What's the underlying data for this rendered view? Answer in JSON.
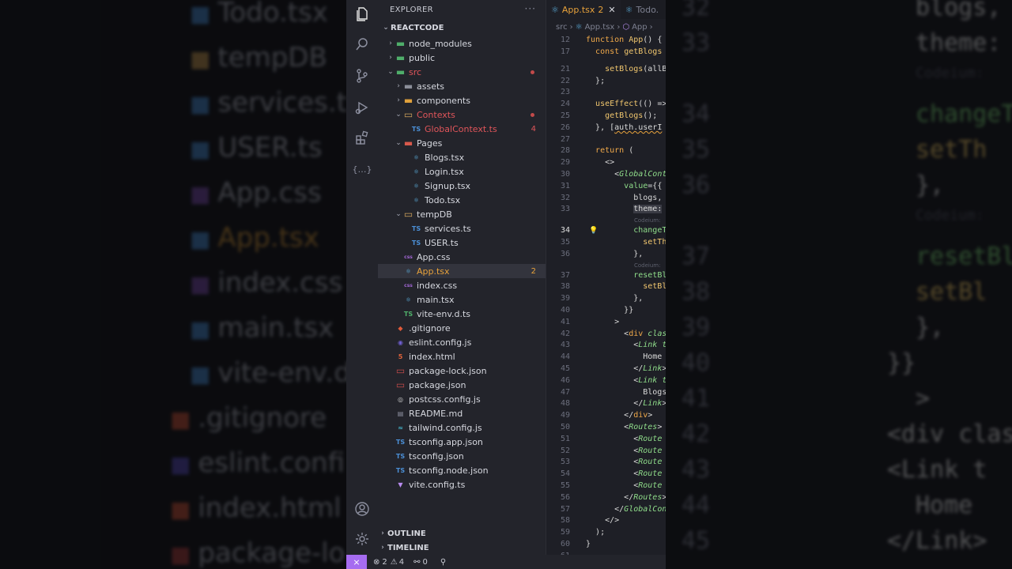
{
  "background_left": {
    "rows": [
      {
        "icon": "typescript-react-icon",
        "label": "Todo.tsx"
      },
      {
        "icon": "folder-icon",
        "label": "tempDB"
      },
      {
        "icon": "typescript-icon",
        "label": "services.ts"
      },
      {
        "icon": "typescript-icon",
        "label": "USER.ts"
      },
      {
        "icon": "css-icon",
        "label": "App.css"
      },
      {
        "icon": "react-icon",
        "label": "App.tsx"
      },
      {
        "icon": "css-icon",
        "label": "index.css"
      },
      {
        "icon": "react-icon",
        "label": "main.tsx"
      },
      {
        "icon": "typescript-icon",
        "label": "vite-env.d"
      },
      {
        "icon": "git-icon",
        "label": ".gitignore"
      },
      {
        "icon": "eslint-icon",
        "label": "eslint.confi"
      },
      {
        "icon": "html-icon",
        "label": "index.html"
      },
      {
        "icon": "npm-icon",
        "label": "package-lo"
      }
    ]
  },
  "background_right": {
    "lines": [
      {
        "num": "32",
        "text": "blogs,"
      },
      {
        "num": "33",
        "text": "theme:"
      },
      {
        "num": "",
        "text": "Codeium:"
      },
      {
        "num": "34",
        "text": "changeT"
      },
      {
        "num": "35",
        "text": "setTh"
      },
      {
        "num": "36",
        "text": "},"
      },
      {
        "num": "",
        "text": "Codeium:"
      },
      {
        "num": "37",
        "text": "resetBl"
      },
      {
        "num": "38",
        "text": "setBl"
      },
      {
        "num": "39",
        "text": "},"
      },
      {
        "num": "40",
        "text": "}}"
      },
      {
        "num": "41",
        "text": ">"
      },
      {
        "num": "42",
        "text": "<div clas"
      },
      {
        "num": "43",
        "text": "<Link t"
      },
      {
        "num": "44",
        "text": "Home"
      },
      {
        "num": "45",
        "text": "</Link>"
      }
    ]
  },
  "explorer": {
    "title": "EXPLORER",
    "more": "···",
    "project": "REACTCODE",
    "outline": "OUTLINE",
    "timeline": "TIMELINE",
    "items": [
      {
        "label": "node_modules",
        "indent": 1,
        "chev": "›",
        "icon": "folder-green",
        "color": "#d6d8df"
      },
      {
        "label": "public",
        "indent": 1,
        "chev": "›",
        "icon": "folder-green",
        "color": "#d6d8df"
      },
      {
        "label": "src",
        "indent": 1,
        "chev": "⌄",
        "icon": "folder-green",
        "color": "#e0555a",
        "dot": true
      },
      {
        "label": "assets",
        "indent": 2,
        "chev": "›",
        "icon": "folder-gray",
        "color": "#d6d8df"
      },
      {
        "label": "components",
        "indent": 2,
        "chev": "›",
        "icon": "folder-orange",
        "color": "#d6d8df"
      },
      {
        "label": "Contexts",
        "indent": 2,
        "chev": "⌄",
        "icon": "folder-open",
        "color": "#e0555a",
        "dot": true
      },
      {
        "label": "GlobalContext.ts",
        "indent": 3,
        "chev": "",
        "icon": "ts",
        "color": "#e0555a",
        "badge": "4"
      },
      {
        "label": "Pages",
        "indent": 2,
        "chev": "⌄",
        "icon": "folder-red",
        "color": "#d6d8df"
      },
      {
        "label": "Blogs.tsx",
        "indent": 3,
        "chev": "",
        "icon": "react",
        "color": "#d6d8df"
      },
      {
        "label": "Login.tsx",
        "indent": 3,
        "chev": "",
        "icon": "react",
        "color": "#d6d8df"
      },
      {
        "label": "Signup.tsx",
        "indent": 3,
        "chev": "",
        "icon": "react",
        "color": "#d6d8df"
      },
      {
        "label": "Todo.tsx",
        "indent": 3,
        "chev": "",
        "icon": "react",
        "color": "#d6d8df"
      },
      {
        "label": "tempDB",
        "indent": 2,
        "chev": "⌄",
        "icon": "folder-open",
        "color": "#d6d8df"
      },
      {
        "label": "services.ts",
        "indent": 3,
        "chev": "",
        "icon": "ts",
        "color": "#d6d8df"
      },
      {
        "label": "USER.ts",
        "indent": 3,
        "chev": "",
        "icon": "ts",
        "color": "#d6d8df"
      },
      {
        "label": "App.css",
        "indent": 2,
        "chev": "",
        "icon": "css",
        "color": "#d6d8df"
      },
      {
        "label": "App.tsx",
        "indent": 2,
        "chev": "",
        "icon": "react",
        "color": "#e8a23b",
        "badge": "2",
        "selected": true
      },
      {
        "label": "index.css",
        "indent": 2,
        "chev": "",
        "icon": "css",
        "color": "#d6d8df"
      },
      {
        "label": "main.tsx",
        "indent": 2,
        "chev": "",
        "icon": "react",
        "color": "#d6d8df"
      },
      {
        "label": "vite-env.d.ts",
        "indent": 2,
        "chev": "",
        "icon": "ts-green",
        "color": "#d6d8df"
      },
      {
        "label": ".gitignore",
        "indent": 1,
        "chev": "",
        "icon": "git",
        "color": "#d6d8df"
      },
      {
        "label": "eslint.config.js",
        "indent": 1,
        "chev": "",
        "icon": "eslint",
        "color": "#d6d8df"
      },
      {
        "label": "index.html",
        "indent": 1,
        "chev": "",
        "icon": "html",
        "color": "#d6d8df"
      },
      {
        "label": "package-lock.json",
        "indent": 1,
        "chev": "",
        "icon": "npm",
        "color": "#d6d8df"
      },
      {
        "label": "package.json",
        "indent": 1,
        "chev": "",
        "icon": "npm",
        "color": "#d6d8df"
      },
      {
        "label": "postcss.config.js",
        "indent": 1,
        "chev": "",
        "icon": "postcss",
        "color": "#d6d8df"
      },
      {
        "label": "README.md",
        "indent": 1,
        "chev": "",
        "icon": "readme",
        "color": "#d6d8df"
      },
      {
        "label": "tailwind.config.js",
        "indent": 1,
        "chev": "",
        "icon": "tailwind",
        "color": "#d6d8df"
      },
      {
        "label": "tsconfig.app.json",
        "indent": 1,
        "chev": "",
        "icon": "tsconfig",
        "color": "#d6d8df"
      },
      {
        "label": "tsconfig.json",
        "indent": 1,
        "chev": "",
        "icon": "tsconfig",
        "color": "#d6d8df"
      },
      {
        "label": "tsconfig.node.json",
        "indent": 1,
        "chev": "",
        "icon": "tsconfig",
        "color": "#d6d8df"
      },
      {
        "label": "vite.config.ts",
        "indent": 1,
        "chev": "",
        "icon": "vite",
        "color": "#d6d8df"
      }
    ]
  },
  "editor": {
    "tabs": [
      {
        "label": "App.tsx",
        "badge": "2",
        "close": "✕",
        "active": true
      },
      {
        "label": "Todo.",
        "active": false
      }
    ],
    "breadcrumbs": [
      "src",
      "›",
      "App.tsx",
      "›",
      "App",
      "›"
    ],
    "codeium_label": "Codeium:",
    "lines": [
      {
        "num": "12",
        "html": "<span class='o'>function</span> <span class='k'>App</span><span class='p'>() {</span>"
      },
      {
        "num": "17",
        "html": "  <span class='o'>const</span> <span class='k'>getBlogs</span>"
      },
      {
        "num": "21",
        "html": "    <span class='k'>setBlogs</span><span class='p'>(allB</span>"
      },
      {
        "num": "22",
        "html": "  <span class='p'>};</span>"
      },
      {
        "num": "23",
        "html": ""
      },
      {
        "num": "24",
        "html": "  <span class='k'>useEffect</span><span class='p'>(() =&gt;</span>"
      },
      {
        "num": "25",
        "html": "    <span class='k'>getBlogs</span><span class='p'>();</span>"
      },
      {
        "num": "26",
        "html": "  <span class='p'>}, [</span><span class='p' style='text-decoration:underline wavy #e8a23b'>auth.userI</span>"
      },
      {
        "num": "27",
        "html": ""
      },
      {
        "num": "28",
        "html": "  <span class='o'>return</span> <span class='p'>(</span>"
      },
      {
        "num": "29",
        "html": "    <span class='p'>&lt;&gt;</span>"
      },
      {
        "num": "30",
        "html": "      <span class='p'>&lt;</span><span class='t'>GlobalCont</span>"
      },
      {
        "num": "31",
        "html": "        <span class='f'>value</span><span class='p'>={{</span>"
      },
      {
        "num": "32",
        "html": "          <span class='p'>blogs,</span>"
      },
      {
        "num": "33",
        "html": "          <span class='p' style='background:#3a3b44'>theme:</span>"
      },
      {
        "num": "34",
        "html": "          <span class='f'>changeT</span>",
        "cur": true,
        "codeium": true,
        "bulb": true
      },
      {
        "num": "35",
        "html": "            <span class='k'>setTh</span>"
      },
      {
        "num": "36",
        "html": "          <span class='p'>},</span>"
      },
      {
        "num": "37",
        "html": "          <span class='f'>resetBl</span>",
        "codeium": true
      },
      {
        "num": "38",
        "html": "            <span class='k'>setBl</span>"
      },
      {
        "num": "39",
        "html": "          <span class='p'>},</span>"
      },
      {
        "num": "40",
        "html": "        <span class='p'>}}</span>"
      },
      {
        "num": "41",
        "html": "      <span class='p'>&gt;</span>"
      },
      {
        "num": "42",
        "html": "        <span class='p'>&lt;</span><span class='o'>div</span> <span class='t'>clas</span>"
      },
      {
        "num": "43",
        "html": "          <span class='p'>&lt;</span><span class='t'>Link</span> <span class='t'>t</span>"
      },
      {
        "num": "44",
        "html": "            <span class='p'>Home</span>"
      },
      {
        "num": "45",
        "html": "          <span class='p'>&lt;/</span><span class='t'>Link</span><span class='p'>&gt;</span>"
      },
      {
        "num": "46",
        "html": "          <span class='p'>&lt;</span><span class='t'>Link</span> <span class='t'>t</span>"
      },
      {
        "num": "47",
        "html": "            <span class='p'>Blogs</span>"
      },
      {
        "num": "48",
        "html": "          <span class='p'>&lt;/</span><span class='t'>Link</span><span class='p'>&gt;</span>"
      },
      {
        "num": "49",
        "html": "        <span class='p'>&lt;/</span><span class='o'>div</span><span class='p'>&gt;</span>"
      },
      {
        "num": "50",
        "html": "        <span class='p'>&lt;</span><span class='t'>Routes</span><span class='p'>&gt;</span>"
      },
      {
        "num": "51",
        "html": "          <span class='p'>&lt;</span><span class='t'>Route</span>"
      },
      {
        "num": "52",
        "html": "          <span class='p'>&lt;</span><span class='t'>Route</span>"
      },
      {
        "num": "53",
        "html": "          <span class='p'>&lt;</span><span class='t'>Route</span>"
      },
      {
        "num": "54",
        "html": "          <span class='p'>&lt;</span><span class='t'>Route</span>"
      },
      {
        "num": "55",
        "html": "          <span class='p'>&lt;</span><span class='t'>Route</span>"
      },
      {
        "num": "56",
        "html": "        <span class='p'>&lt;/</span><span class='t'>Routes</span><span class='p'>&gt;</span>"
      },
      {
        "num": "57",
        "html": "      <span class='p'>&lt;/</span><span class='t'>GlobalCon</span>"
      },
      {
        "num": "58",
        "html": "    <span class='p'>&lt;/&gt;</span>"
      },
      {
        "num": "59",
        "html": "  <span class='p'>);</span>"
      },
      {
        "num": "60",
        "html": "<span class='p'>}</span>"
      },
      {
        "num": "61",
        "html": ""
      }
    ]
  },
  "status": {
    "remote_icon": "⨯",
    "errors": "2",
    "warnings": "4",
    "ports": "0"
  }
}
